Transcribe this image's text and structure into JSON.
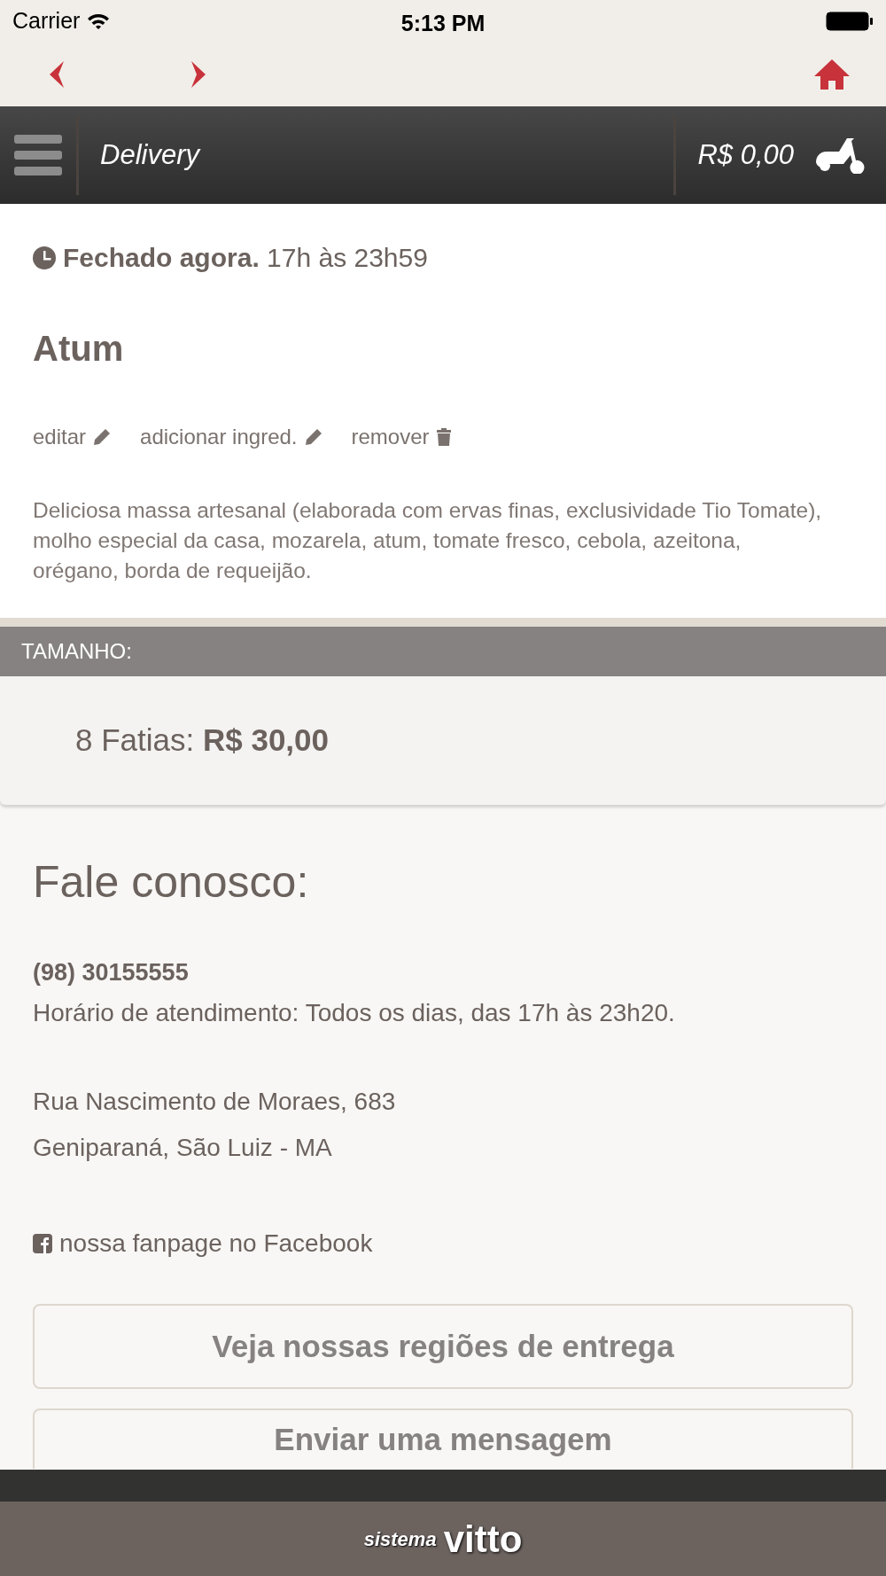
{
  "status_bar": {
    "carrier": "Carrier",
    "time": "5:13 PM"
  },
  "header": {
    "title": "Delivery",
    "cart_total": "R$ 0,00"
  },
  "hours": "**Fechado agora.** 17h às 23h59",
  "product": {
    "name": "Atum",
    "actions": [
      {
        "label": "editar",
        "kind": "edit"
      },
      {
        "label": "adicionar ingred.",
        "kind": "edit"
      },
      {
        "label": "remover",
        "kind": "delete"
      }
    ],
    "description": "Deliciosa massa artesanal (elaborada com ervas finas, exclusividade Tio Tomate), molho especial da casa, mozarela, atum, tomate fresco, cebola, azeitona, orégano, borda de requeijão."
  },
  "size_section": {
    "heading": "TAMANHO:",
    "options": [
      {
        "label": "8 Fatias: **R$ 30,00**"
      }
    ]
  },
  "contact": {
    "heading": "Fale conosco:",
    "phone": "(98) 30155555",
    "hours": "Horário de atendimento: Todos os dias, das 17h às 23h20.",
    "address_lines": [
      "Rua Nascimento de Moraes, 683",
      "Geniparaná, São Luiz - MA"
    ],
    "facebook_link": "nossa fanpage no Facebook",
    "buttons": [
      "Veja nossas regiões de entrega",
      "Enviar uma mensagem"
    ]
  },
  "footer": {
    "brand_prefix": "sistema",
    "brand_name": "vitto"
  }
}
